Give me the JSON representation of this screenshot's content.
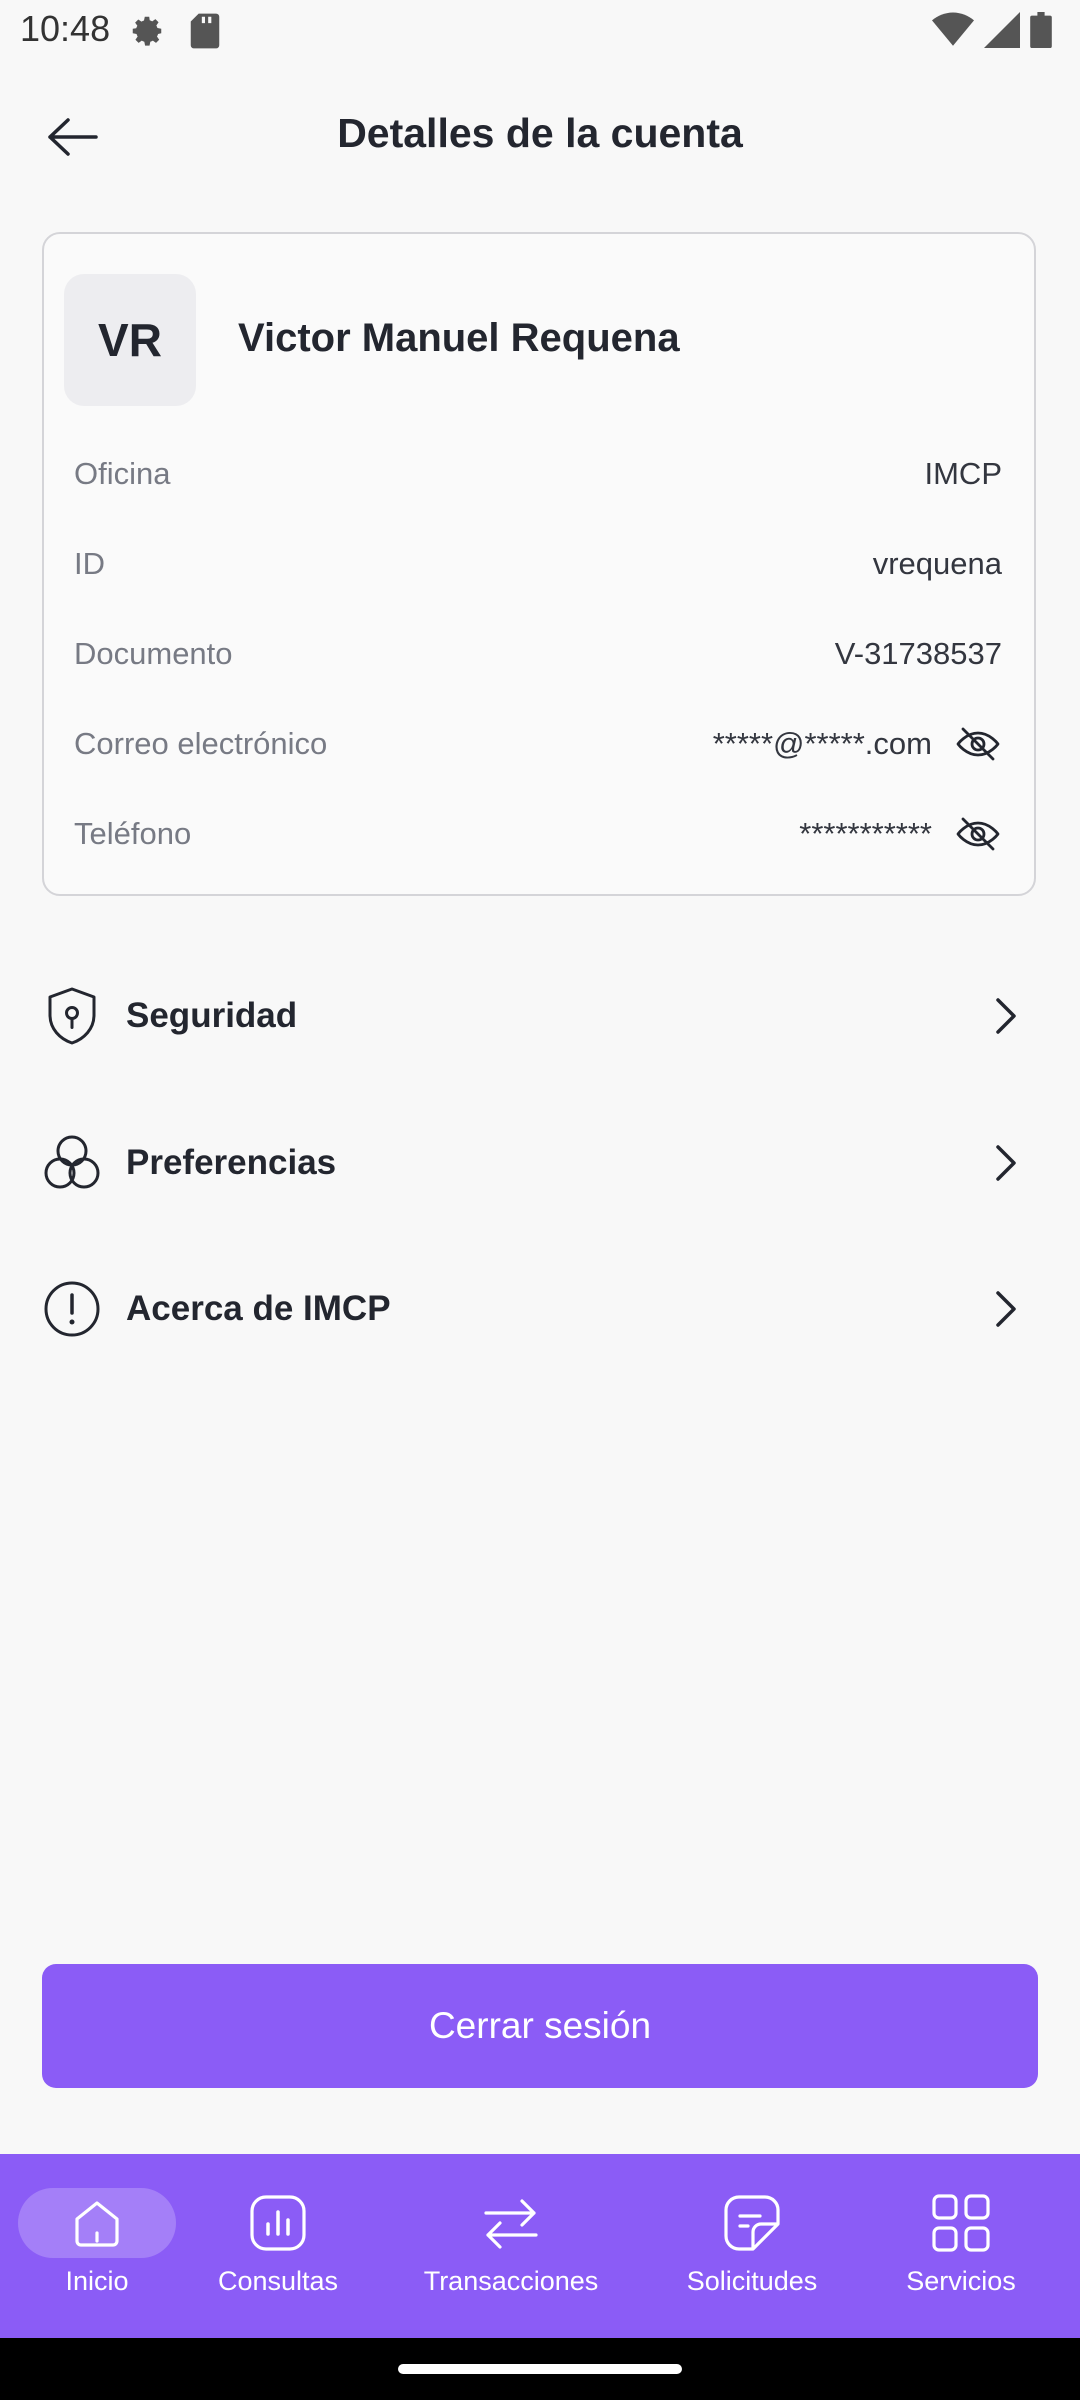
{
  "status_bar": {
    "time": "10:48",
    "icons": [
      "gear-icon",
      "sd-card-icon",
      "wifi-icon",
      "signal-icon",
      "battery-icon"
    ]
  },
  "header": {
    "title": "Detalles de la cuenta",
    "back_icon": "arrow-left-icon"
  },
  "account": {
    "initials": "VR",
    "name": "Victor Manuel Requena",
    "fields": {
      "office": {
        "label": "Oficina",
        "value": "IMCP"
      },
      "id": {
        "label": "ID",
        "value": "vrequena"
      },
      "document": {
        "label": "Documento",
        "value": "V-31738537"
      },
      "email": {
        "label": "Correo electrónico",
        "value": "*****@*****.com",
        "icon": "eye-off-icon"
      },
      "phone": {
        "label": "Teléfono",
        "value": "***********",
        "icon": "eye-off-icon"
      }
    }
  },
  "menu": {
    "security": {
      "label": "Seguridad",
      "icon": "shield-lock-icon"
    },
    "preferences": {
      "label": "Preferencias",
      "icon": "circles-icon"
    },
    "about": {
      "label": "Acerca de IMCP",
      "icon": "info-circle-icon"
    }
  },
  "logout": {
    "label": "Cerrar sesión"
  },
  "bottom_nav": {
    "home": {
      "label": "Inicio",
      "icon": "home-icon",
      "active": true
    },
    "queries": {
      "label": "Consultas",
      "icon": "bar-chart-icon"
    },
    "transactions": {
      "label": "Transacciones",
      "icon": "transfer-arrows-icon"
    },
    "requests": {
      "label": "Solicitudes",
      "icon": "document-icon"
    },
    "services": {
      "label": "Servicios",
      "icon": "grid-icon"
    }
  },
  "colors": {
    "accent": "#8b5cf6",
    "background": "#f8f8f8",
    "text": "#23262f",
    "muted_text": "#777a84"
  }
}
